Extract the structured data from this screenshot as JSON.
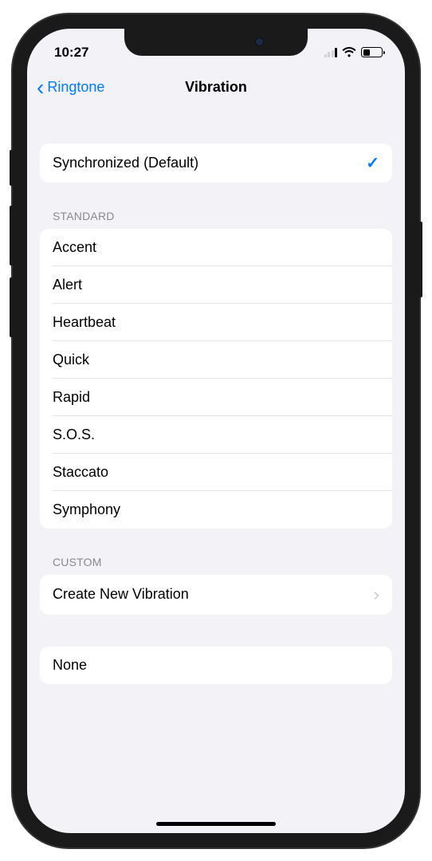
{
  "statusBar": {
    "time": "10:27"
  },
  "nav": {
    "backLabel": "Ringtone",
    "title": "Vibration"
  },
  "defaultSection": {
    "items": [
      {
        "label": "Synchronized (Default)",
        "selected": true
      }
    ]
  },
  "standardSection": {
    "header": "STANDARD",
    "items": [
      {
        "label": "Accent"
      },
      {
        "label": "Alert"
      },
      {
        "label": "Heartbeat"
      },
      {
        "label": "Quick"
      },
      {
        "label": "Rapid"
      },
      {
        "label": "S.O.S."
      },
      {
        "label": "Staccato"
      },
      {
        "label": "Symphony"
      }
    ]
  },
  "customSection": {
    "header": "CUSTOM",
    "createLabel": "Create New Vibration"
  },
  "noneSection": {
    "label": "None"
  }
}
